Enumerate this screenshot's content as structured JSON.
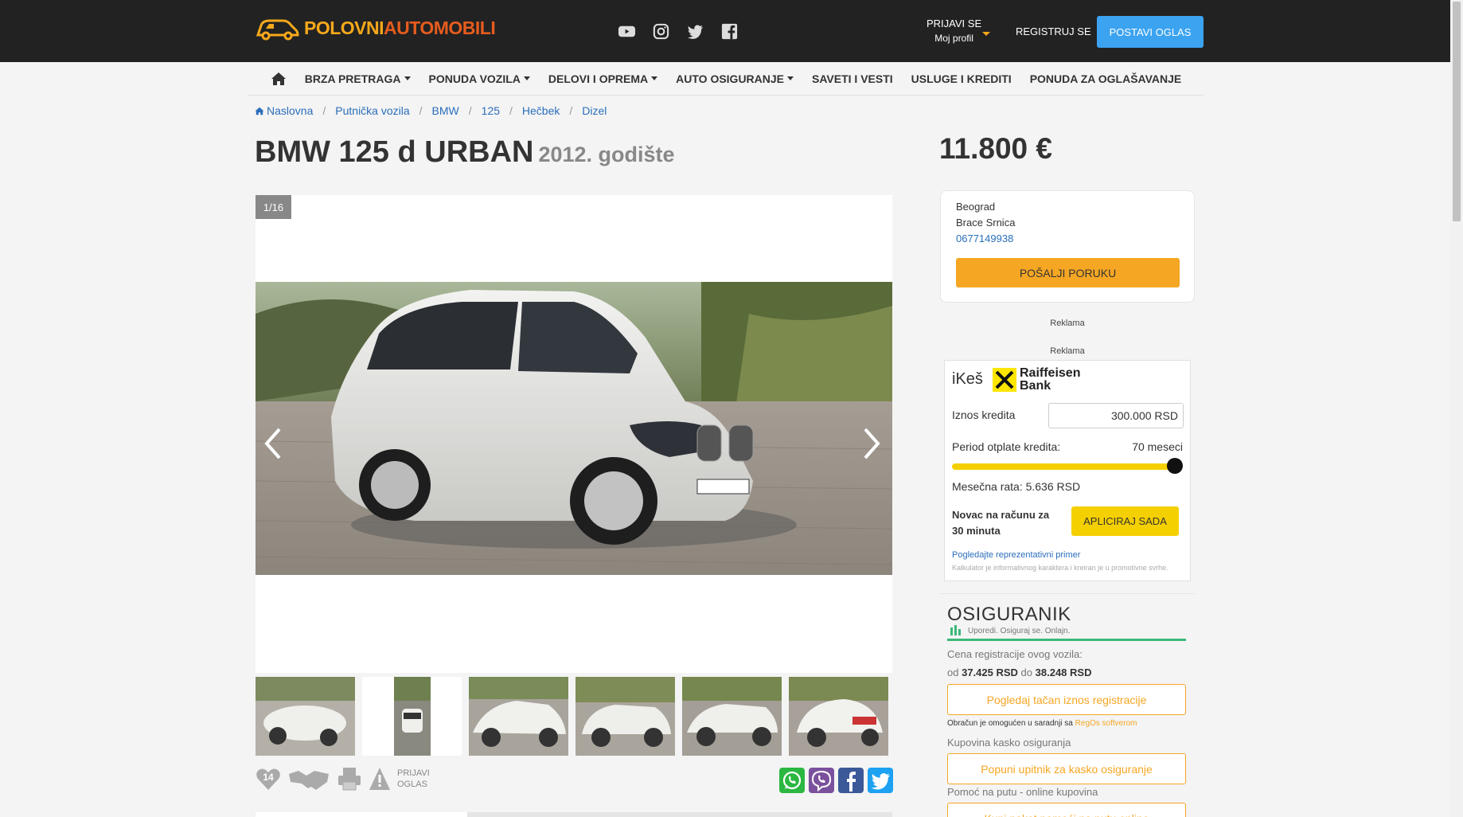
{
  "brand": {
    "word1": "POLOVNI",
    "word2": "AUTOMOBILI"
  },
  "header": {
    "social": [
      "youtube-icon",
      "instagram-icon",
      "twitter-icon",
      "facebook-icon"
    ],
    "login_label": "PRIJAVI SE",
    "profile_label": "Moj profil",
    "register_label": "REGISTRUJ SE",
    "post_ad_label": "POSTAVI OGLAS"
  },
  "nav": {
    "items": [
      {
        "label": "BRZA PRETRAGA"
      },
      {
        "label": "PONUDA VOZILA"
      },
      {
        "label": "DELOVI I OPREMA"
      },
      {
        "label": "AUTO OSIGURANJE"
      },
      {
        "label": "SAVETI I VESTI"
      },
      {
        "label": "USLUGE I KREDITI"
      },
      {
        "label": "PONUDA ZA OGLAŠAVANJE"
      }
    ]
  },
  "breadcrumb": [
    "Naslovna",
    "Putnička vozila",
    "BMW",
    "125",
    "Hečbek",
    "Dizel"
  ],
  "listing": {
    "title": "BMW 125 d URBAN",
    "year": "2012. godište",
    "price": "11.800 €",
    "photo_counter": "1/16",
    "favorites_count": "14",
    "report_line1": "PRIJAVI",
    "report_line2": "OGLAS"
  },
  "seller": {
    "city": "Beograd",
    "street": "Brace Srnica",
    "phone": "0677149938",
    "message_button": "POŠALJI PORUKU"
  },
  "ads": {
    "label": "Reklama"
  },
  "loan": {
    "brand": "iKeš",
    "bank_line1": "Raiffeisen",
    "bank_line2": "Bank",
    "amount_label": "Iznos kredita",
    "amount_value": "300.000  RSD",
    "period_label": "Period otplate kredita:",
    "period_value": "70 meseci",
    "period_fraction": 1.0,
    "monthly": "Mesečna rata: 5.636 RSD",
    "fast_line": "Novac na računu za 30 minuta",
    "apply_label": "APLICIRAJ SADA",
    "example_link": "Pogledajte reprezentativni primer",
    "disclaimer": "Kalkulator je informativnog karaktera i kreiran je u promotivne svrhe."
  },
  "insurance": {
    "logo": "OSIGURANIK",
    "tagline": "Uporedi. Osiguraj se. Onlajn.",
    "reg_label": "Cena registracije ovog vozila:",
    "reg_from_word": "od",
    "reg_from": "37.425 RSD",
    "reg_to_word": "do",
    "reg_to": "38.248 RSD",
    "reg_button": "Pogledaj tačan iznos registracije",
    "regos_text": "Obračun je omogućen u saradnji sa",
    "regos_link": "RegOs softverom",
    "kasko_label": "Kupovina kasko osiguranja",
    "kasko_button": "Popuni upitnik za kasko osiguranje",
    "help_label": "Pomoć na putu - online kupovina",
    "help_button": "Kupi paket pomoći na putu online"
  },
  "colors": {
    "accent_orange": "#f5a623",
    "brand_blue": "#3ba3f0",
    "raiffeisen_yellow": "#f5d000",
    "osiguranik_green": "#3cb878"
  }
}
